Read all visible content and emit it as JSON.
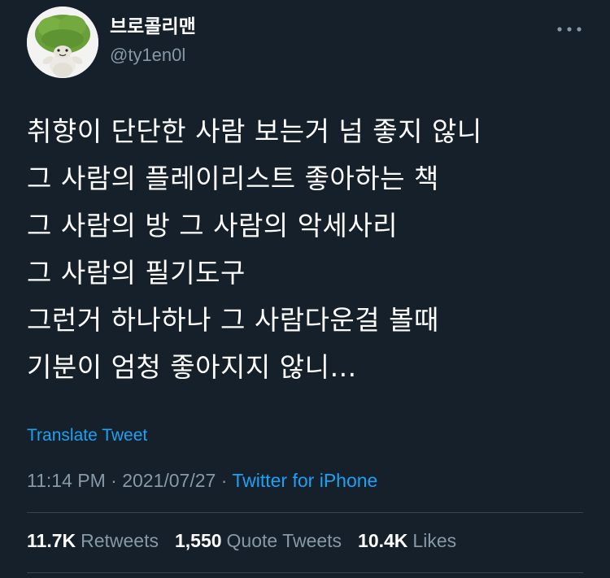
{
  "author": {
    "display_name": "브로콜리맨",
    "handle": "@ty1en0l",
    "avatar_icon": "broccoli-plush-avatar-icon"
  },
  "header": {
    "more_icon": "more-horizontal-icon"
  },
  "tweet": {
    "lines": [
      "취향이 단단한 사람 보는거 넘 좋지 않니",
      "그 사람의 플레이리스트 좋아하는 책",
      "그 사람의 방 그 사람의 악세사리",
      "그 사람의 필기도구",
      "그런거 하나하나 그 사람다운걸 볼때",
      "기분이 엄청 좋아지지 않니…"
    ],
    "translate_label": "Translate Tweet"
  },
  "meta": {
    "time": "11:14 PM",
    "separator": " · ",
    "date": "2021/07/27",
    "separator2": " · ",
    "source": "Twitter for iPhone"
  },
  "stats": {
    "retweets_count": "11.7K",
    "retweets_label": "Retweets",
    "quote_count": "1,550",
    "quote_label": "Quote Tweets",
    "likes_count": "10.4K",
    "likes_label": "Likes"
  },
  "colors": {
    "background": "#15202b",
    "accent": "#1da1f2",
    "secondary_text": "#8899a6",
    "divider": "#38444d"
  }
}
